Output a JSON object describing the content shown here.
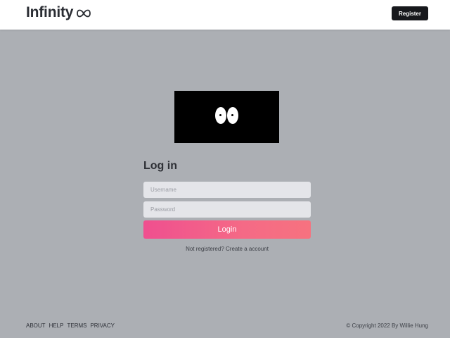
{
  "header": {
    "brand_name": "Infinity",
    "brand_icon": "infinity-icon",
    "register_label": "Register"
  },
  "hero": {
    "icon": "eyes-icon",
    "background": "#000000"
  },
  "login": {
    "title": "Log in",
    "username_placeholder": "Username",
    "username_value": "",
    "password_placeholder": "Password",
    "password_value": "",
    "submit_label": "Login",
    "signup_text": "Not registered? Create a account"
  },
  "footer": {
    "links": [
      "ABOUT",
      "HELP",
      "TERMS",
      "PRIVACY"
    ],
    "copyright": "© Copyright 2022 By Willie Hung"
  },
  "colors": {
    "page_background": "#acafb4",
    "header_background": "#ffffff",
    "register_button": "#17181c",
    "login_gradient_start": "#ef4f8f",
    "login_gradient_end": "#f7727f",
    "input_background": "#e4e5e9"
  }
}
